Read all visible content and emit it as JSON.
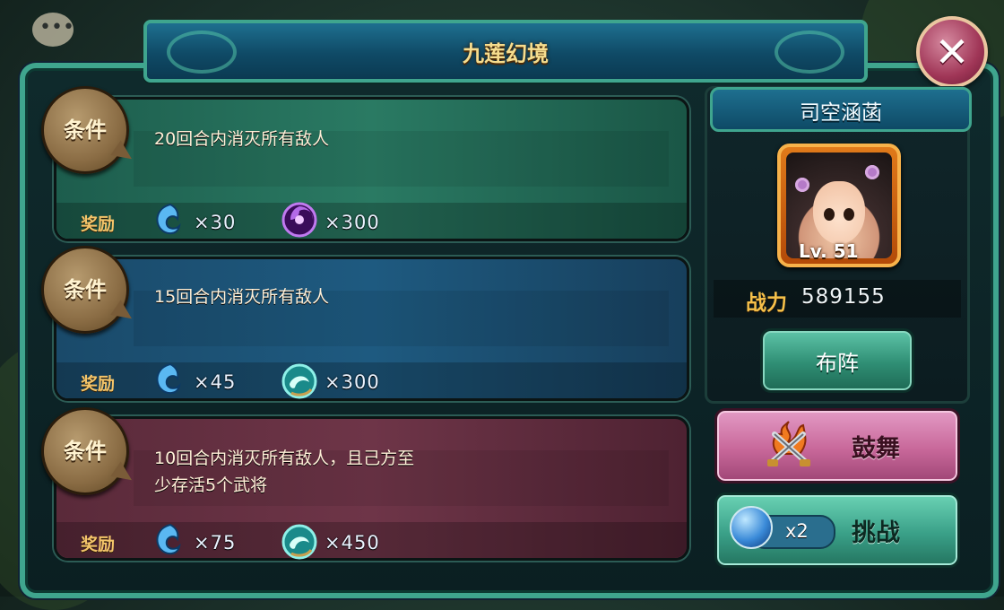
{
  "window": {
    "title": "九莲幻境"
  },
  "missions": [
    {
      "condition_badge": "条件",
      "condition": "20回合内消灭所有敌人",
      "reward_label": "奖励",
      "rewards": [
        {
          "icon": "blue-soul-drop-icon",
          "amount": "×30"
        },
        {
          "icon": "purple-vortex-orb-icon",
          "amount": "×300"
        }
      ]
    },
    {
      "condition_badge": "条件",
      "condition": "15回合内消灭所有敌人",
      "reward_label": "奖励",
      "rewards": [
        {
          "icon": "blue-soul-drop-icon",
          "amount": "×45"
        },
        {
          "icon": "jade-swirl-orb-icon",
          "amount": "×300"
        }
      ]
    },
    {
      "condition_badge": "条件",
      "condition_line1": "10回合内消灭所有敌人，且己方至",
      "condition_line2": "少存活5个武将",
      "reward_label": "奖励",
      "rewards": [
        {
          "icon": "blue-soul-drop-icon",
          "amount": "×75"
        },
        {
          "icon": "jade-swirl-orb-icon",
          "amount": "×450"
        }
      ]
    }
  ],
  "hero": {
    "name": "司空涵菡",
    "level": "Lv. 51",
    "power_label": "战力",
    "power_value": "589155"
  },
  "buttons": {
    "formation": "布阵",
    "cheer": "鼓舞",
    "challenge": "挑战",
    "challenge_cost": "x2"
  },
  "colors": {
    "frame": "#3fa58e",
    "title_text": "#f6dd8e",
    "panel1": "#2a7a63",
    "panel2": "#1e5a80",
    "panel3": "#6e3548",
    "cheer_button": "#c8689a",
    "challenge_button": "#3aa088"
  }
}
